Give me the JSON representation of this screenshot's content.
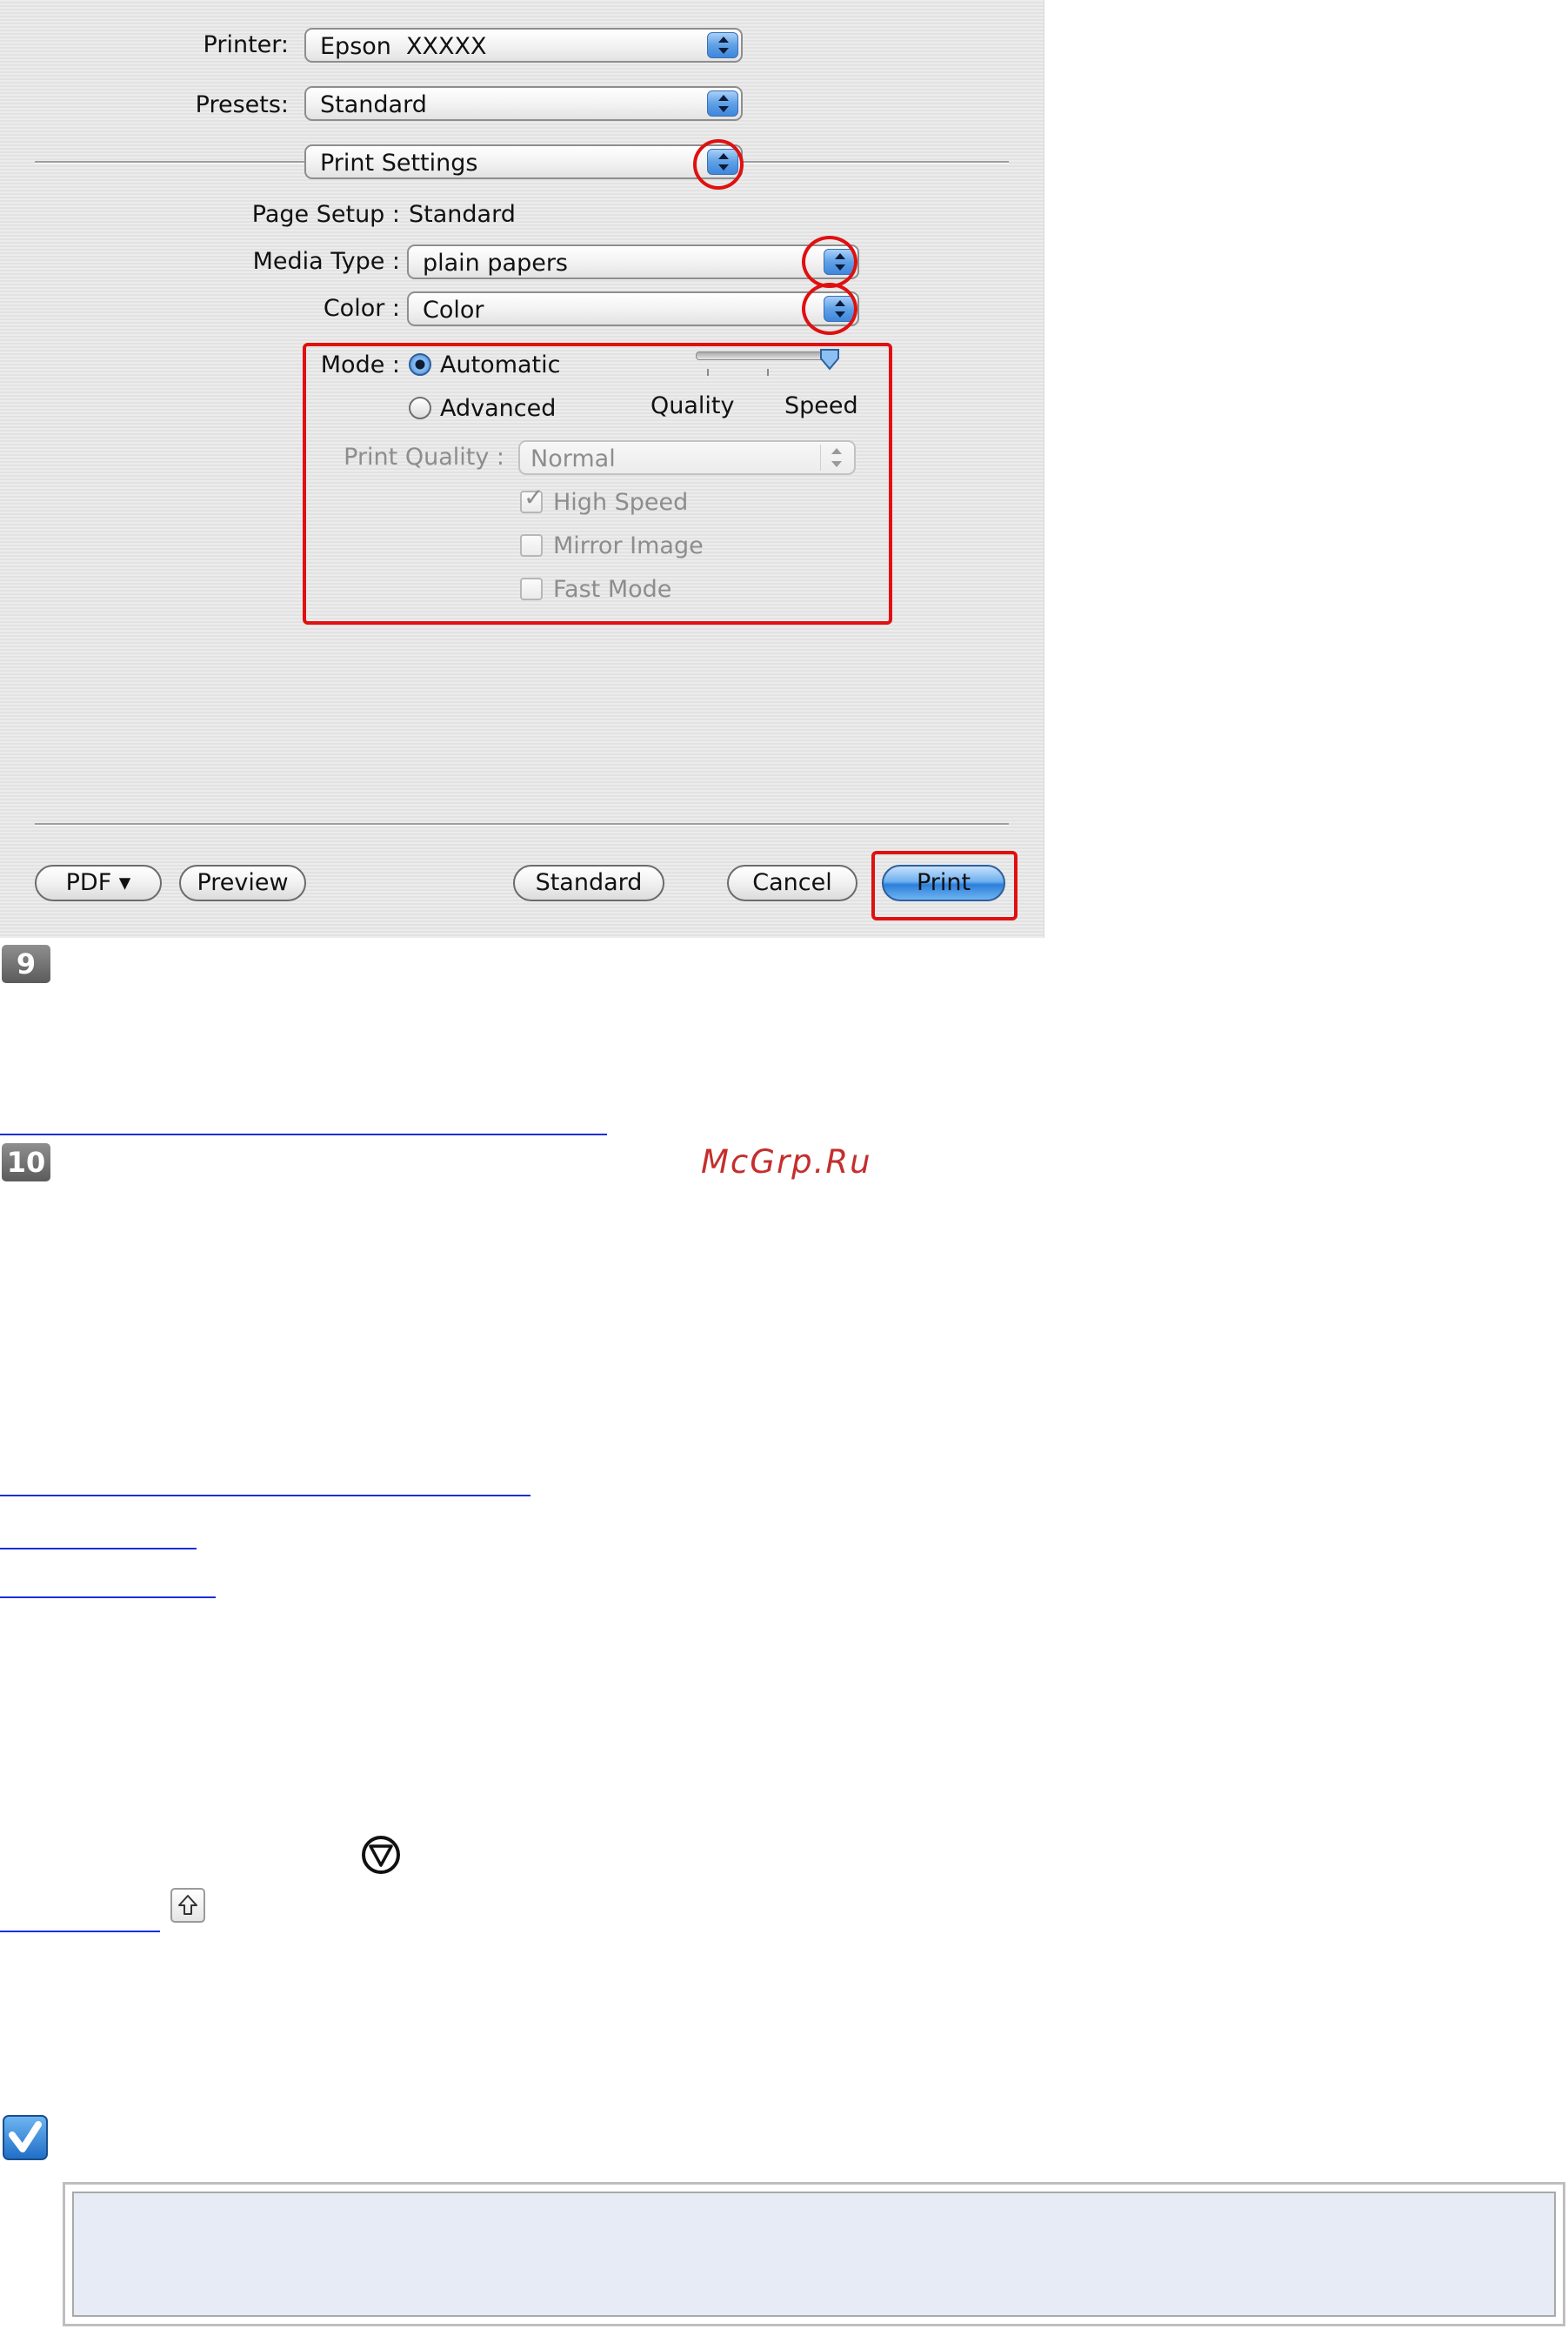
{
  "dialog": {
    "printer_label": "Printer:",
    "printer_value": "Epson  XXXXX",
    "presets_label": "Presets:",
    "presets_value": "Standard",
    "panel_value": "Print Settings",
    "page_setup_label": "Page Setup :",
    "page_setup_value": "Standard",
    "media_type_label": "Media Type :",
    "media_type_value": "plain papers",
    "color_label": "Color :",
    "color_value": "Color",
    "mode_label": "Mode :",
    "mode_options": [
      "Automatic",
      "Advanced"
    ],
    "mode_selected": "Automatic",
    "slider_labels": [
      "Quality",
      "Speed"
    ],
    "slider_level": 1.0,
    "print_quality_label": "Print Quality :",
    "print_quality_value": "Normal",
    "checkboxes": [
      {
        "label": "High Speed",
        "checked": true
      },
      {
        "label": "Mirror Image",
        "checked": false
      },
      {
        "label": "Fast Mode",
        "checked": false
      }
    ],
    "buttons": {
      "pdf": "PDF ▾",
      "preview": "Preview",
      "standard": "Standard",
      "cancel": "Cancel",
      "print": "Print"
    }
  },
  "steps": [
    "9",
    "10"
  ],
  "watermark": "McGrp.Ru",
  "icons": {
    "stop": "stop-button-icon",
    "home": "home-arrow-icon",
    "note": "note-checkmark-icon"
  },
  "colors": {
    "highlight_red": "#e01010",
    "link_blue": "#1a2fd6",
    "accent_blue": "#3e86dc",
    "note_bg": "#e7ebf6"
  }
}
